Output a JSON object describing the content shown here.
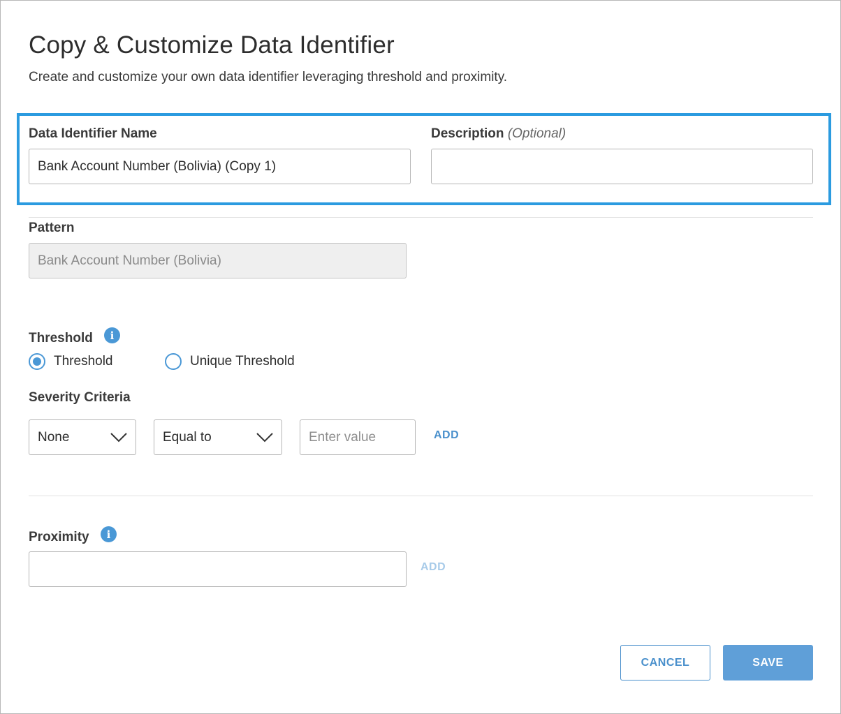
{
  "dialog": {
    "title": "Copy & Customize Data Identifier",
    "subtitle": "Create and customize your own data identifier leveraging threshold and proximity."
  },
  "name_field": {
    "label": "Data Identifier Name",
    "value": "Bank Account Number (Bolivia) (Copy 1)"
  },
  "description_field": {
    "label": "Description",
    "optional_label": "(Optional)",
    "value": ""
  },
  "pattern_field": {
    "label": "Pattern",
    "value": "Bank Account Number (Bolivia)",
    "disabled": true
  },
  "threshold": {
    "label": "Threshold",
    "info_icon": "info-icon",
    "options": [
      {
        "label": "Threshold",
        "selected": true
      },
      {
        "label": "Unique Threshold",
        "selected": false
      }
    ]
  },
  "severity_criteria": {
    "label": "Severity Criteria",
    "level_select": "None",
    "operator_select": "Equal to",
    "value_placeholder": "Enter value",
    "add_label": "ADD"
  },
  "proximity": {
    "label": "Proximity",
    "info_icon": "info-icon",
    "value": "",
    "add_label": "ADD"
  },
  "footer": {
    "cancel_label": "CANCEL",
    "save_label": "SAVE"
  },
  "colors": {
    "accent": "#4a90cc",
    "highlight_border": "#2b9be0",
    "save_bg": "#5f9fd8"
  }
}
